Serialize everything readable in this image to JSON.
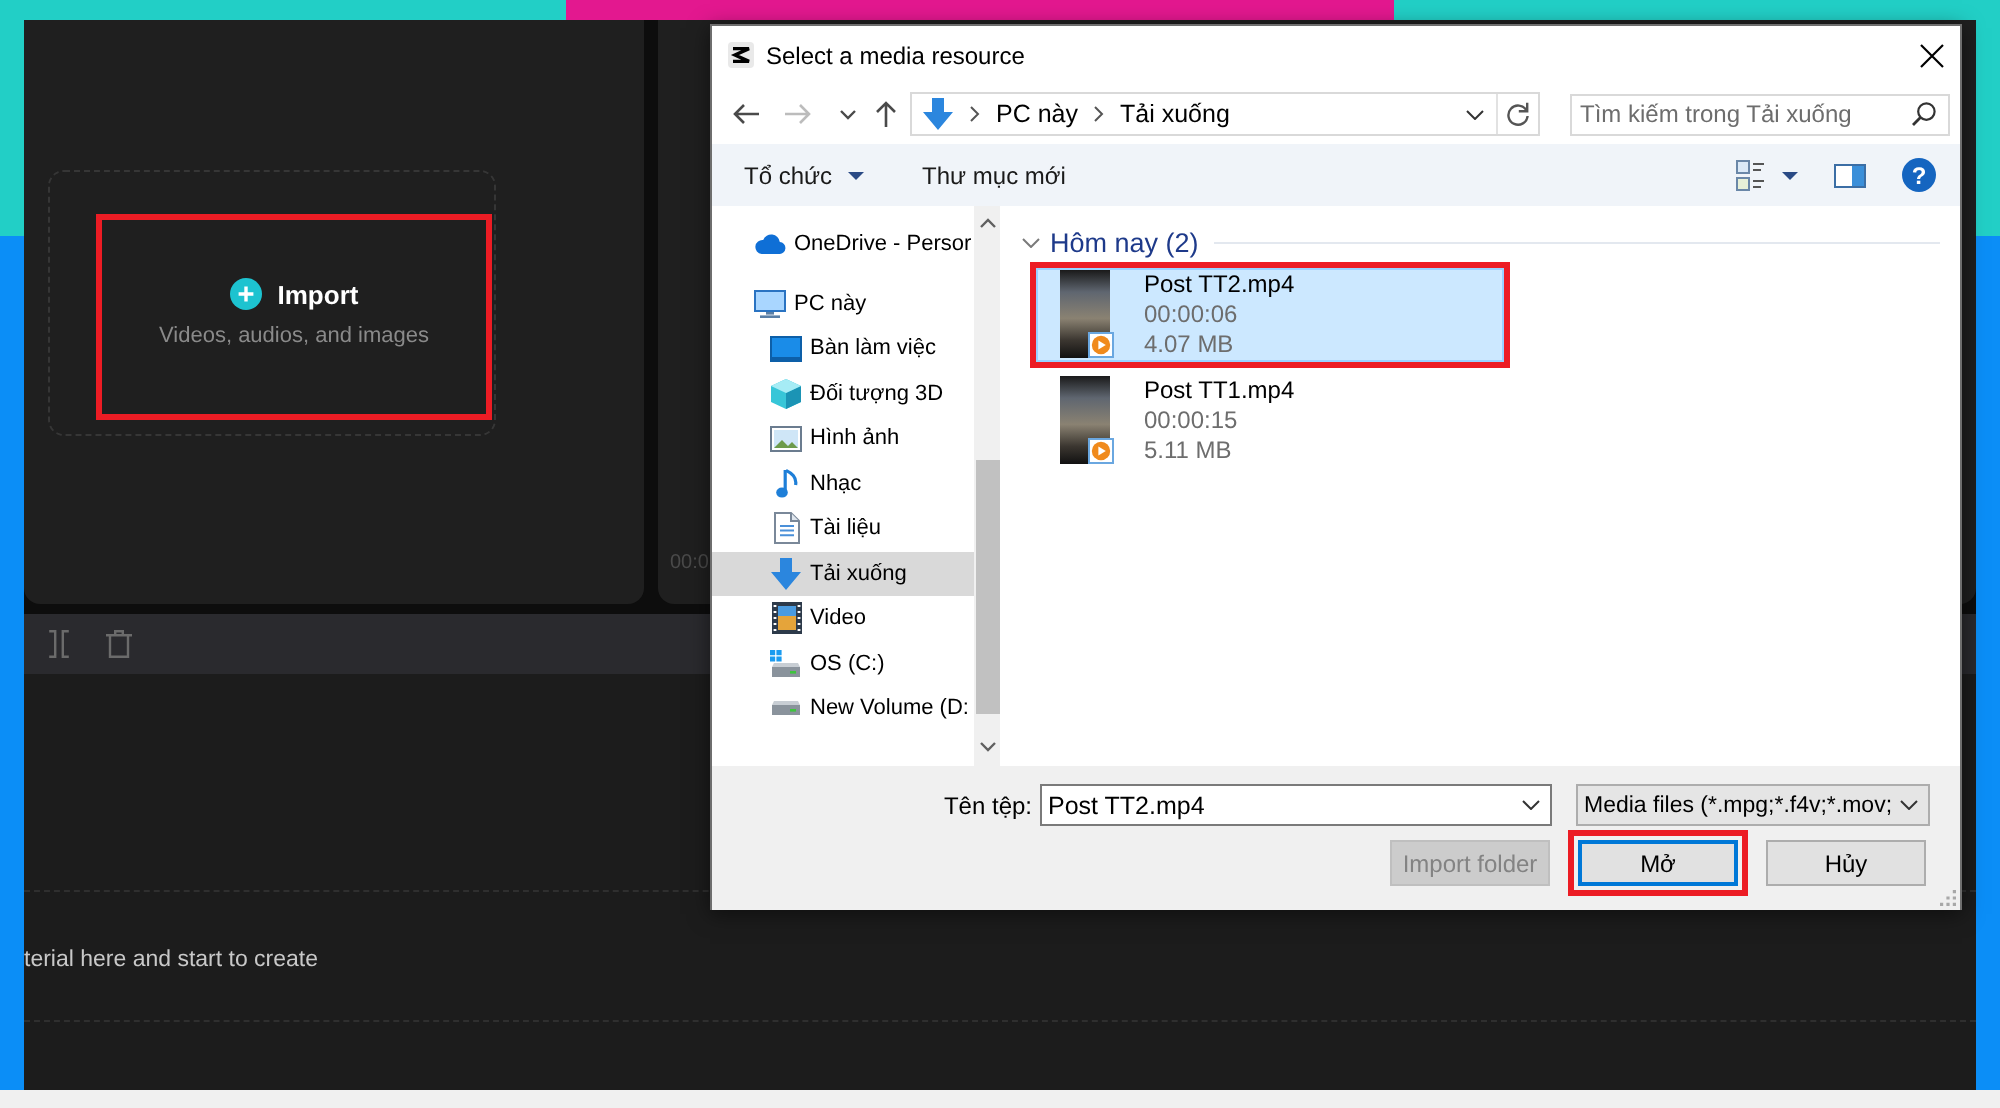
{
  "editor": {
    "import_card": {
      "title": "Import",
      "subtitle": "Videos, audios, and images",
      "highlighted": true
    },
    "player": {
      "timecode": "00:0"
    },
    "timeline": {
      "hint": "terial here and start to create"
    }
  },
  "dialog": {
    "title": "Select a media resource",
    "nav_buttons": [
      {
        "kind": "back",
        "disabled": false
      },
      {
        "kind": "forward",
        "disabled": true
      },
      {
        "kind": "recent",
        "disabled": false
      },
      {
        "kind": "up",
        "disabled": false
      }
    ],
    "address": {
      "path": [
        "PC này",
        "Tải xuống"
      ]
    },
    "search": {
      "placeholder": "Tìm kiếm trong Tải xuống"
    },
    "commands": {
      "organize": "Tổ chức",
      "new_folder": "Thư mục mới",
      "help": "?"
    },
    "nav_pane": [
      {
        "label": "OneDrive - Persor",
        "kind": "cloud",
        "selected": false
      },
      {
        "label": "PC này",
        "kind": "computer",
        "selected": false,
        "children": [
          {
            "label": "Bàn làm việc",
            "kind": "desktop",
            "selected": false
          },
          {
            "label": "Đối tượng 3D",
            "kind": "cube",
            "selected": false
          },
          {
            "label": "Hình ảnh",
            "kind": "pictures",
            "selected": false
          },
          {
            "label": "Nhạc",
            "kind": "music",
            "selected": false
          },
          {
            "label": "Tài liệu",
            "kind": "document",
            "selected": false
          },
          {
            "label": "Tải xuống",
            "kind": "download",
            "selected": true
          },
          {
            "label": "Video",
            "kind": "video",
            "selected": false
          },
          {
            "label": "OS (C:)",
            "kind": "system_drive",
            "selected": false
          },
          {
            "label": "New Volume (D:",
            "kind": "drive",
            "selected": false
          }
        ]
      }
    ],
    "files_group": {
      "header": "Hôm nay (2)",
      "expanded": true,
      "files": [
        {
          "name": "Post TT2.mp4",
          "duration": "00:00:06",
          "size": "4.07 MB",
          "selected": true,
          "highlighted": true
        },
        {
          "name": "Post TT1.mp4",
          "duration": "00:00:15",
          "size": "5.11 MB",
          "selected": false,
          "highlighted": false
        }
      ]
    },
    "file_name": {
      "label": "Tên tệp:",
      "value": "Post TT2.mp4"
    },
    "file_type": {
      "value": "Media files (*.mpg;*.f4v;*.mov;"
    },
    "buttons": [
      {
        "label": "Import folder",
        "disabled": true,
        "default": false,
        "highlighted": false
      },
      {
        "label": "Mở",
        "disabled": false,
        "default": true,
        "highlighted": true
      },
      {
        "label": "Hủy",
        "disabled": false,
        "default": false,
        "highlighted": false
      }
    ]
  }
}
